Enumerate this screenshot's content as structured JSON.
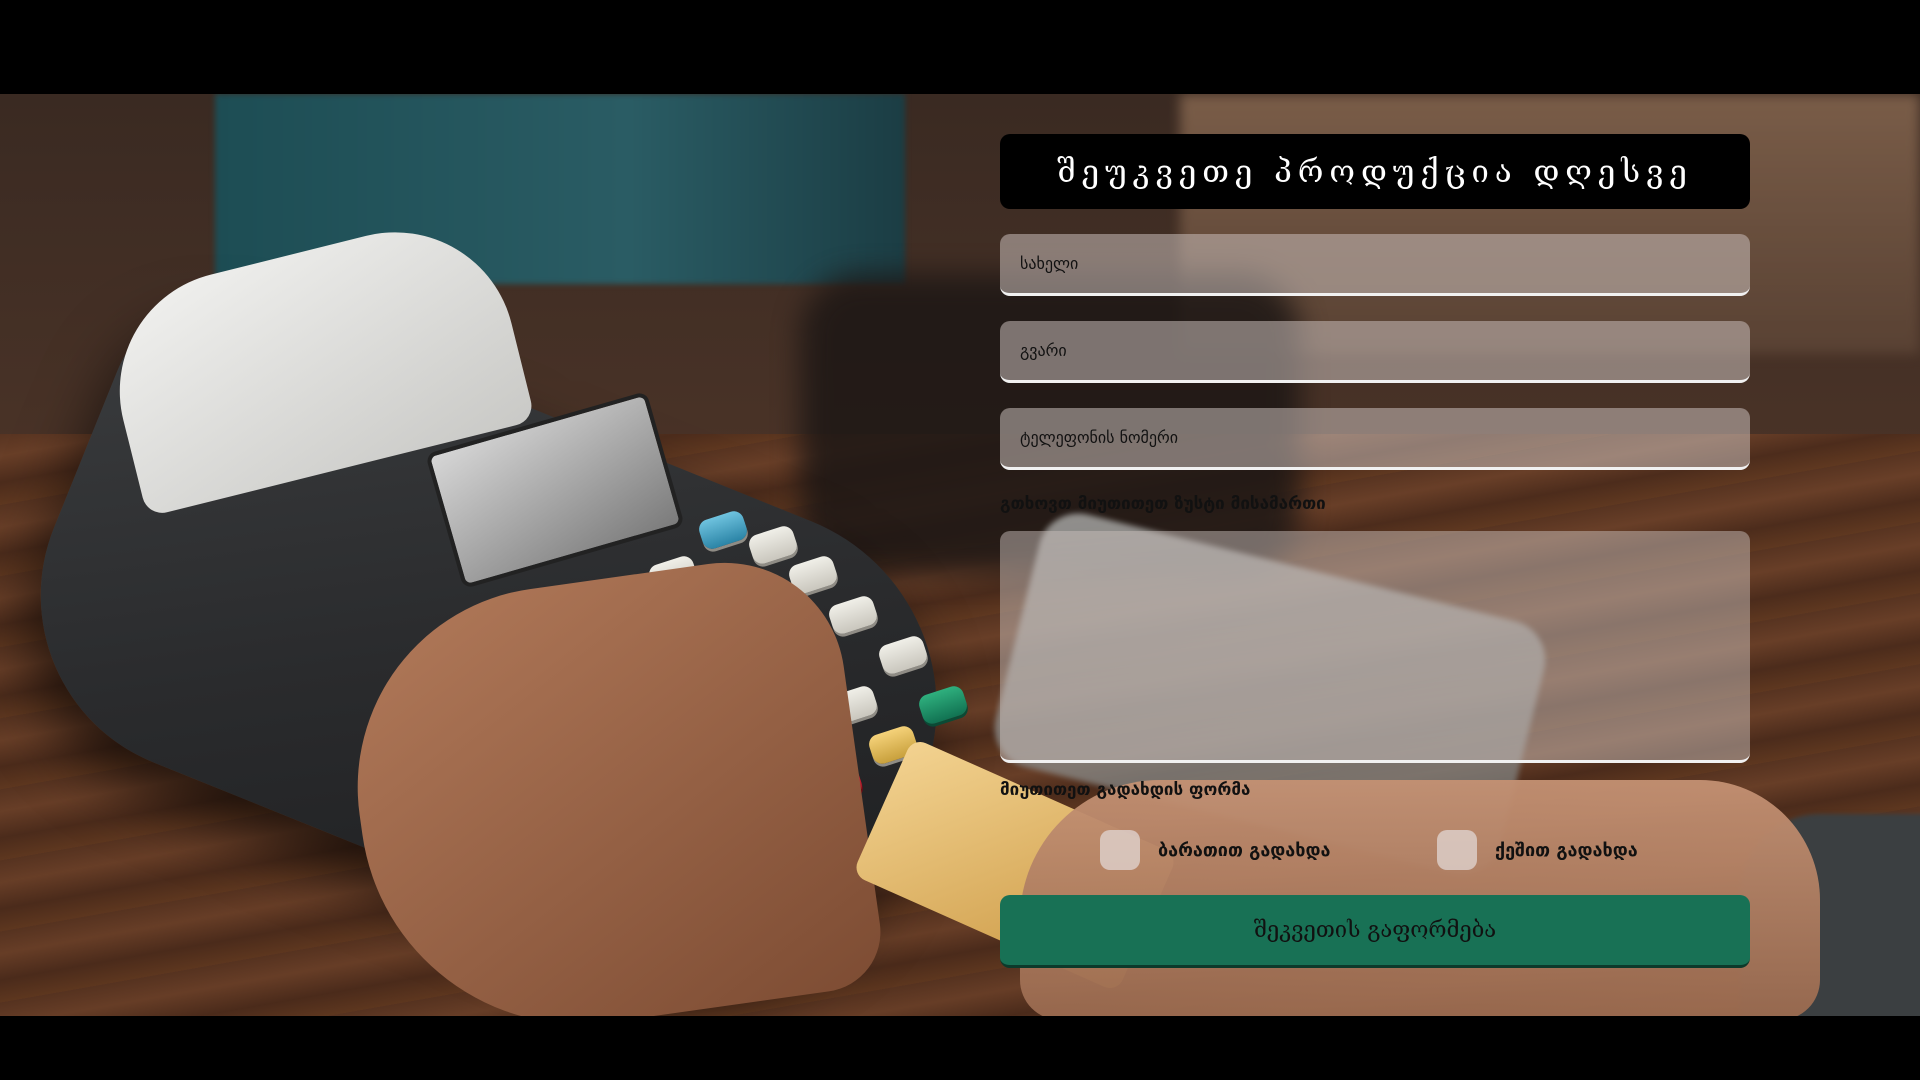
{
  "form": {
    "title": "შეუკვეთე პროდუქცია დღესვე",
    "name_placeholder": "სახელი",
    "surname_placeholder": "გვარი",
    "phone_placeholder": "ტელეფონის ნომერი",
    "address_label": "გთხოვთ მიუთითეთ ზუსტი მისამართი",
    "payment_label": "მიუთითეთ გადახდის ფორმა",
    "payment_options": [
      {
        "label": "ბარათით გადახდა"
      },
      {
        "label": "ქეშით გადახდა"
      }
    ],
    "submit_label": "შეკვეთის გაფორმება"
  },
  "colors": {
    "title_bg": "#000000",
    "submit_bg": "#187155",
    "field_bg": "rgba(200,190,185,0.55)"
  }
}
